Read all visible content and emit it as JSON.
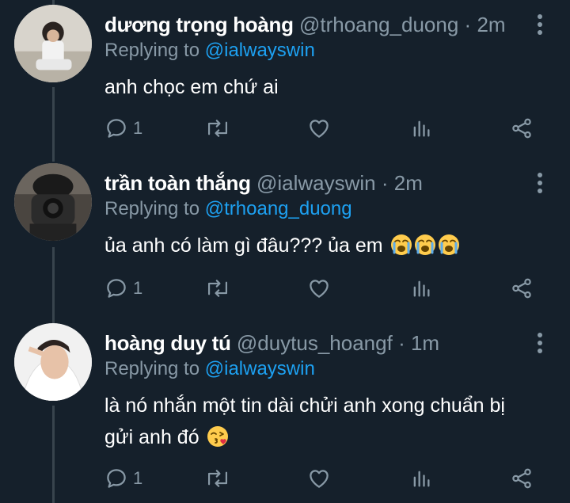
{
  "tweets": [
    {
      "name": "dương trọng hoàng",
      "handle": "@trhoang_duong",
      "separator": "·",
      "time": "2m",
      "replying_prefix": "Replying to",
      "replying_to": "@ialwayswin",
      "text": "anh chọc em chứ ai",
      "text_line2": "",
      "emojis": [],
      "reply_count": "1"
    },
    {
      "name": "trần toàn thắng",
      "handle": "@ialwayswin",
      "separator": "·",
      "time": "2m",
      "replying_prefix": "Replying to",
      "replying_to": "@trhoang_duong",
      "text": "ủa anh có làm gì đâu??? ủa em",
      "text_line2": "",
      "emojis": [
        "loudly-crying-face",
        "loudly-crying-face",
        "loudly-crying-face"
      ],
      "reply_count": "1"
    },
    {
      "name": "hoàng duy tú",
      "handle": "@duytus_hoangf",
      "separator": "·",
      "time": "1m",
      "replying_prefix": "Replying to",
      "replying_to": "@ialwayswin",
      "text": "là nó nhắn một tin dài chửi anh xong chuẩn bị",
      "text_line2": "gửi anh đó",
      "emojis": [
        "face-blowing-a-kiss"
      ],
      "reply_count": "1"
    }
  ],
  "colors": {
    "background": "#15202b",
    "text": "#ffffff",
    "muted": "#8899a6",
    "link": "#1da1f2",
    "thread_line": "#38444d"
  }
}
